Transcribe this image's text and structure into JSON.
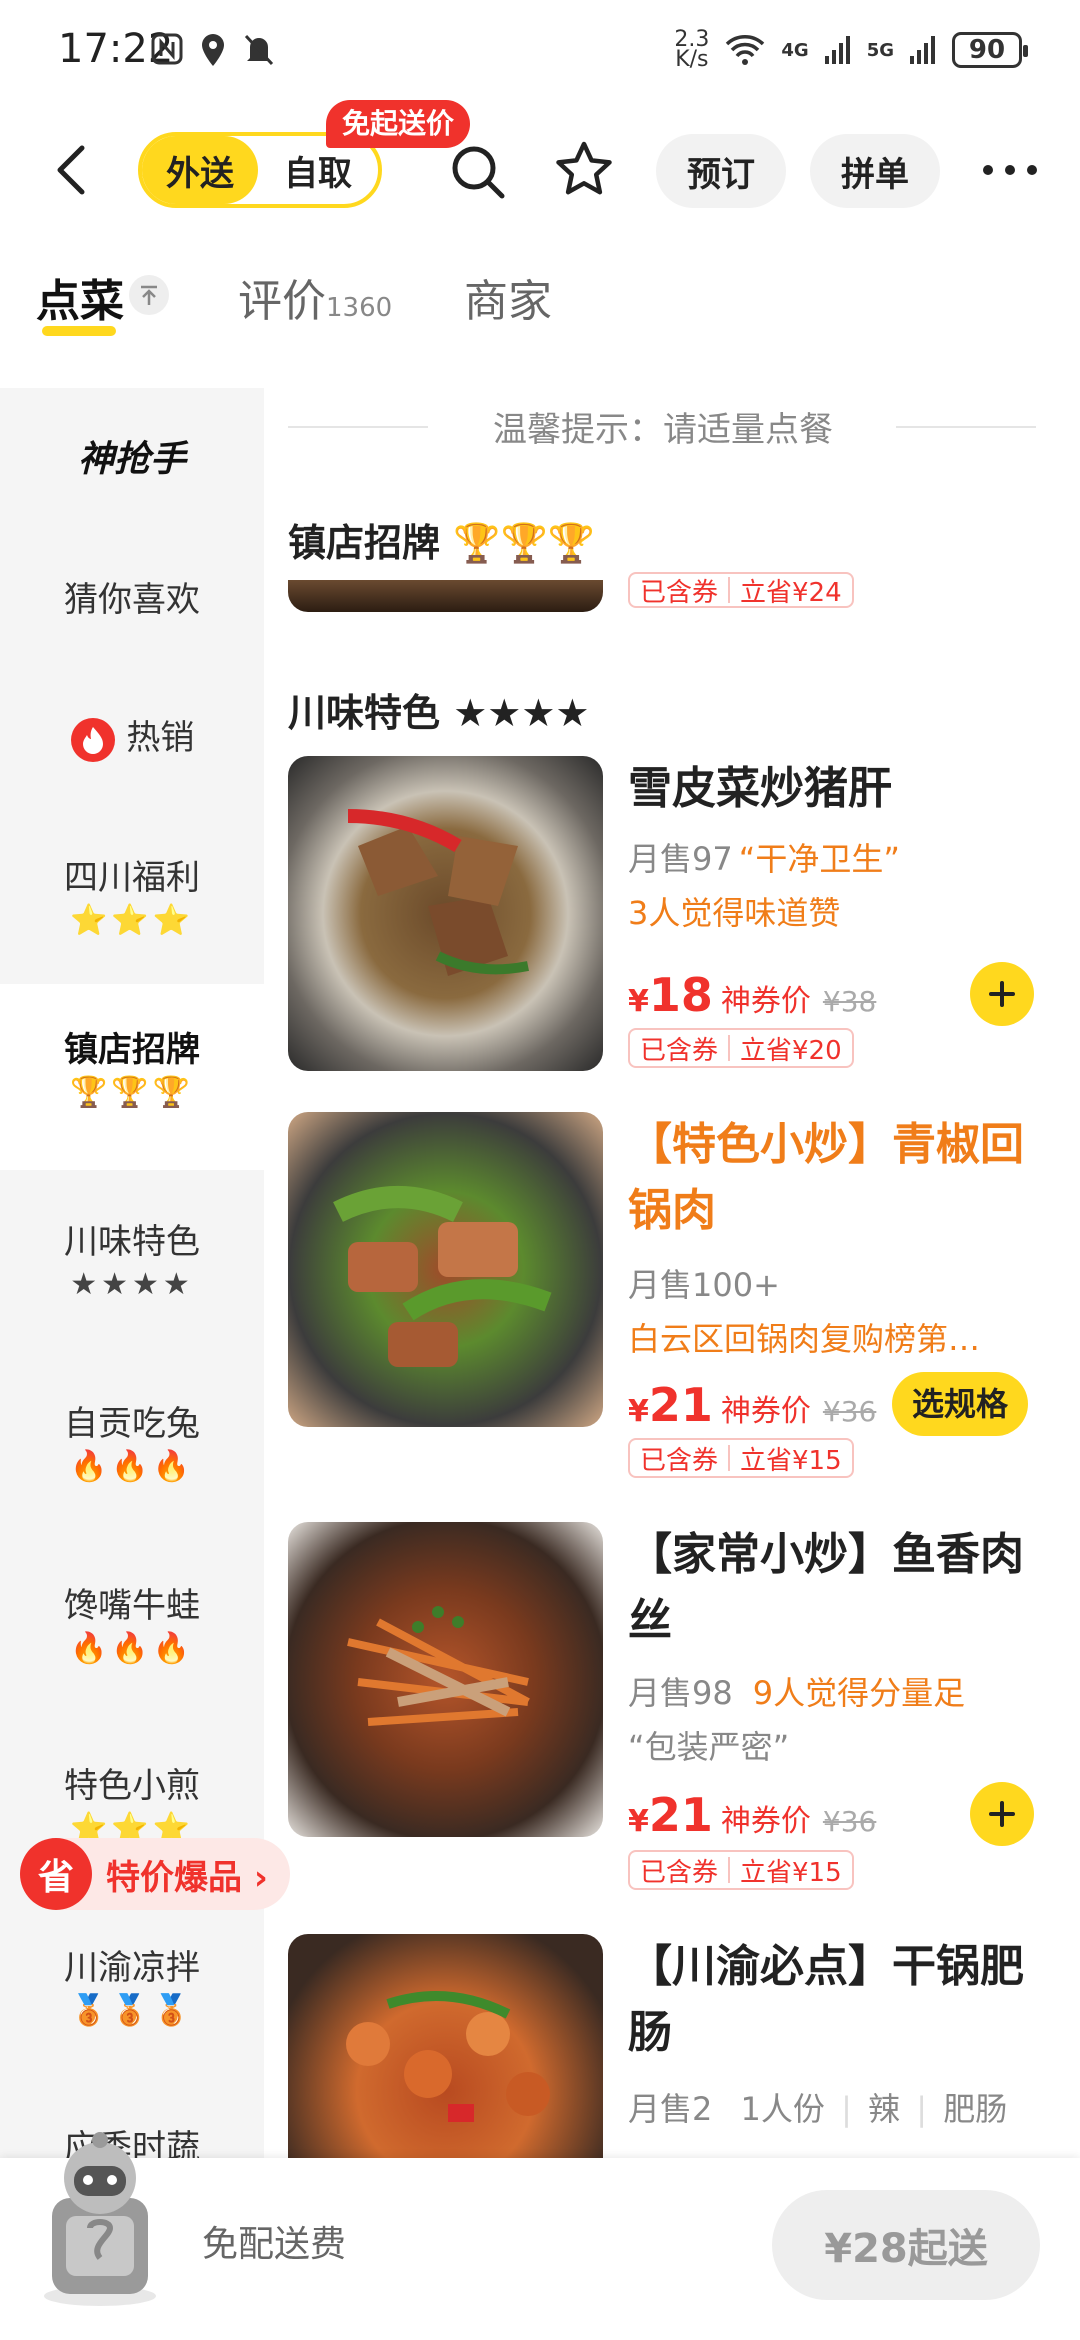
{
  "status": {
    "time": "17:22",
    "speed": "2.3\nK/s",
    "speed_top": "2.3",
    "speed_bottom": "K/s",
    "net1": "4G",
    "net2": "5G",
    "battery": "90"
  },
  "header": {
    "mode_active": "外送",
    "mode_other": "自取",
    "free_badge": "免起送价",
    "reserve": "预订",
    "group": "拼单"
  },
  "tabs": [
    {
      "label": "点菜"
    },
    {
      "label": "评价",
      "count": "1360"
    },
    {
      "label": "商家"
    }
  ],
  "sidebar": [
    {
      "label": "神抢手"
    },
    {
      "label": "猜你喜欢"
    },
    {
      "label": "热销"
    },
    {
      "label": "四川福利",
      "deco": "⭐⭐⭐"
    },
    {
      "label": "镇店招牌",
      "deco": "🏆🏆🏆"
    },
    {
      "label": "川味特色",
      "deco": "★★★★"
    },
    {
      "label": "自贡吃兔",
      "deco": "🔥🔥🔥"
    },
    {
      "label": "馋嘴牛蛙",
      "deco": "🔥🔥🔥"
    },
    {
      "label": "特色小煎",
      "deco": "⭐⭐⭐"
    },
    {
      "label": "川渝凉拌",
      "deco": "🥉🥉🥉"
    },
    {
      "label": "应季时蔬"
    }
  ],
  "main": {
    "tip": "温馨提示：请适量点餐",
    "section1": "镇店招牌 🏆🏆🏆",
    "partial_coupon": {
      "included": "已含券",
      "save": "立省¥24"
    },
    "section2": "川味特色 ★★★★",
    "dishes": [
      {
        "name": "雪皮菜炒猪肝",
        "sold": "月售97",
        "quote": "“干净卫生”",
        "tag": "3人觉得味道赞",
        "currency": "¥",
        "price": "18",
        "price_label": "神券价",
        "original": "¥38",
        "coupon_included": "已含券",
        "coupon_save": "立省¥20"
      },
      {
        "name_prefix": "【特色小炒】",
        "name": "青椒回锅肉",
        "sold": "月售100+",
        "tag": "白云区回锅肉复购榜第…",
        "currency": "¥",
        "price": "21",
        "price_label": "神券价",
        "original": "¥36",
        "spec": "选规格",
        "coupon_included": "已含券",
        "coupon_save": "立省¥15"
      },
      {
        "name": "【家常小炒】鱼香肉丝",
        "sold": "月售98",
        "tag": "9人觉得分量足",
        "quote": "“包装严密”",
        "currency": "¥",
        "price": "21",
        "price_label": "神券价",
        "original": "¥36",
        "coupon_included": "已含券",
        "coupon_save": "立省¥15"
      },
      {
        "name": "【川渝必点】干锅肥肠",
        "sold": "月售2",
        "attrs": [
          "1人份",
          "辣",
          "肥肠"
        ]
      }
    ]
  },
  "promo": {
    "save": "省",
    "label": "特价爆品 ›"
  },
  "bottom": {
    "free_delivery": "免配送费",
    "min_order": "¥28起送"
  },
  "colors": {
    "brand_yellow": "#ffd81e",
    "price_red": "#f0322c",
    "tag_orange": "#f07d19"
  }
}
